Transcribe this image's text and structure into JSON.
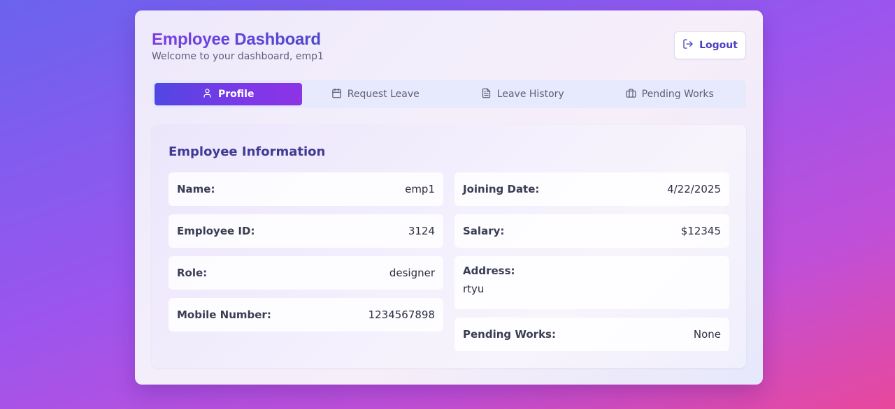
{
  "header": {
    "title": "Employee Dashboard",
    "subtitle": "Welcome to your dashboard, emp1",
    "logout_label": "Logout",
    "logout_icon": "logout-icon"
  },
  "tabs": [
    {
      "label": "Profile",
      "icon": "user-icon",
      "active": true
    },
    {
      "label": "Request Leave",
      "icon": "calendar-icon",
      "active": false
    },
    {
      "label": "Leave History",
      "icon": "document-icon",
      "active": false
    },
    {
      "label": "Pending Works",
      "icon": "briefcase-icon",
      "active": false
    }
  ],
  "profile": {
    "section_title": "Employee Information",
    "left": [
      {
        "label": "Name:",
        "value": "emp1"
      },
      {
        "label": "Employee ID:",
        "value": "3124"
      },
      {
        "label": "Role:",
        "value": "designer"
      },
      {
        "label": "Mobile Number:",
        "value": "1234567898"
      }
    ],
    "right": [
      {
        "label": "Joining Date:",
        "value": "4/22/2025"
      },
      {
        "label": "Salary:",
        "value": "$12345"
      },
      {
        "label": "Address:",
        "value": "rtyu"
      },
      {
        "label": "Pending Works:",
        "value": "None"
      }
    ]
  },
  "colors": {
    "accent_start": "#5147e2",
    "accent_end": "#8c34e6",
    "title_text": "#3f3a94"
  }
}
